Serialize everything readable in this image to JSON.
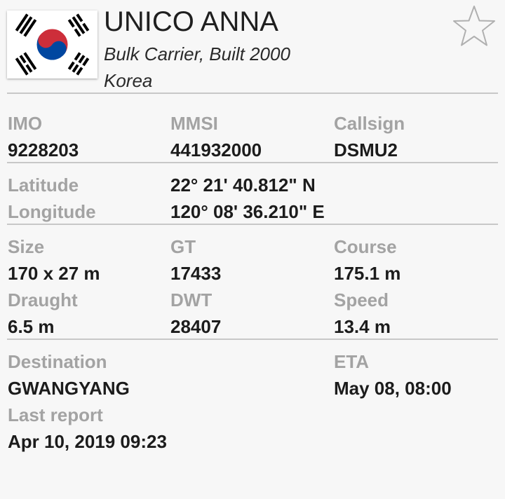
{
  "header": {
    "flag_icon": "south-korea-flag-icon",
    "title": "UNICO ANNA",
    "subtitle": "Bulk Carrier, Built 2000",
    "country": "Korea",
    "favorite_icon": "star-outline-icon"
  },
  "ids": {
    "imo_label": "IMO",
    "imo": "9228203",
    "mmsi_label": "MMSI",
    "mmsi": "441932000",
    "callsign_label": "Callsign",
    "callsign": "DSMU2"
  },
  "position": {
    "latitude_label": "Latitude",
    "latitude": "22° 21' 40.812\" N",
    "longitude_label": "Longitude",
    "longitude": "120° 08' 36.210\" E"
  },
  "dimensions": {
    "size_label": "Size",
    "size": "170 x 27 m",
    "gt_label": "GT",
    "gt": "17433",
    "course_label": "Course",
    "course": "175.1 m",
    "draught_label": "Draught",
    "draught": "6.5 m",
    "dwt_label": "DWT",
    "dwt": "28407",
    "speed_label": "Speed",
    "speed": "13.4 m"
  },
  "voyage": {
    "destination_label": "Destination",
    "destination": "GWANGYANG",
    "eta_label": "ETA",
    "eta": "May 08, 08:00",
    "last_report_label": "Last report",
    "last_report": "Apr 10, 2019 09:23"
  },
  "colors": {
    "background": "#f7f7f7",
    "label": "#a3a3a3",
    "value": "#1c1c1c",
    "divider": "#c8c8c8",
    "flag_red": "#cd2e3a",
    "flag_blue": "#0047a0"
  }
}
